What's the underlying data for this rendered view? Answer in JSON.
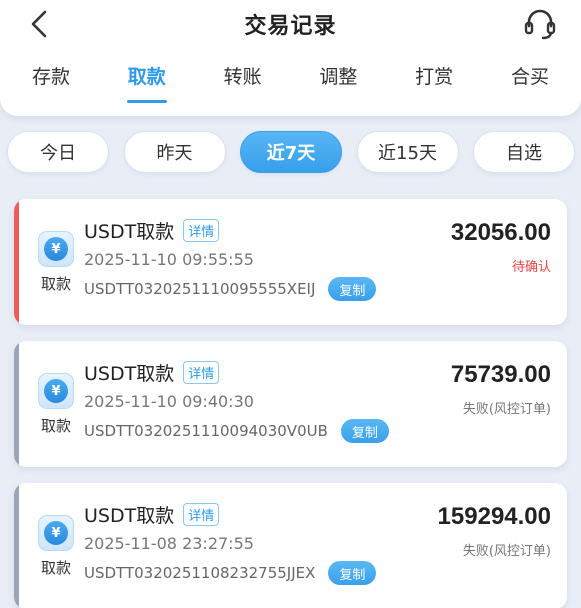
{
  "header": {
    "title": "交易记录",
    "back_icon": "chevron-left-icon",
    "support_icon": "headset-icon"
  },
  "tabs": [
    {
      "label": "存款",
      "active": false
    },
    {
      "label": "取款",
      "active": true
    },
    {
      "label": "转账",
      "active": false
    },
    {
      "label": "调整",
      "active": false
    },
    {
      "label": "打赏",
      "active": false
    },
    {
      "label": "合买",
      "active": false
    }
  ],
  "filters": [
    {
      "label": "今日",
      "active": false
    },
    {
      "label": "昨天",
      "active": false
    },
    {
      "label": "近7天",
      "active": true
    },
    {
      "label": "近15天",
      "active": false
    },
    {
      "label": "自选",
      "active": false
    }
  ],
  "records": [
    {
      "coin_label": "取款",
      "title": "USDT取款",
      "detail_label": "详情",
      "time": "2025-11-10 09:55:55",
      "order_no": "USDTT0320251110095555XEIJ",
      "copy_label": "复制",
      "amount": "32056.00",
      "status": "待确认",
      "status_color": "#e84545",
      "stripe_color": "#f05a5a"
    },
    {
      "coin_label": "取款",
      "title": "USDT取款",
      "detail_label": "详情",
      "time": "2025-11-10 09:40:30",
      "order_no": "USDTT0320251110094030V0UB",
      "copy_label": "复制",
      "amount": "75739.00",
      "status": "失败(风控订单)",
      "status_color": "#777777",
      "stripe_color": "#9aa6b8"
    },
    {
      "coin_label": "取款",
      "title": "USDT取款",
      "detail_label": "详情",
      "time": "2025-11-08 23:27:55",
      "order_no": "USDTT0320251108232755JJEX",
      "copy_label": "复制",
      "amount": "159294.00",
      "status": "失败(风控订单)",
      "status_color": "#777777",
      "stripe_color": "#9aa6b8"
    }
  ],
  "colors": {
    "accent": "#2e9be8",
    "background": "#e9eef6"
  }
}
